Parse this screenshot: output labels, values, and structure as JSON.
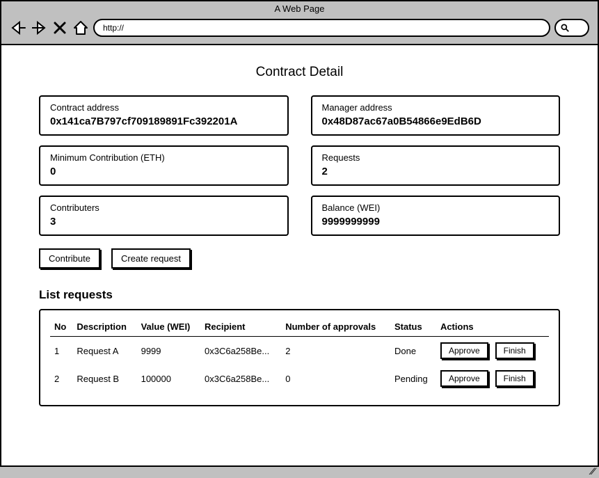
{
  "chrome": {
    "title": "A Web Page",
    "url": "http://"
  },
  "page": {
    "title": "Contract Detail",
    "cards": {
      "contract_address": {
        "label": "Contract address",
        "value": "0x141ca7B797cf709189891Fc392201A"
      },
      "manager_address": {
        "label": "Manager address",
        "value": "0x48D87ac67a0B54866e9EdB6D"
      },
      "min_contribution": {
        "label": "Minimum Contribution (ETH)",
        "value": "0"
      },
      "requests": {
        "label": "Requests",
        "value": "2"
      },
      "contributors": {
        "label": "Contributers",
        "value": "3"
      },
      "balance": {
        "label": "Balance (WEI)",
        "value": "9999999999"
      }
    },
    "actions": {
      "contribute": "Contribute",
      "create_request": "Create request"
    },
    "requests_section": {
      "title": "List requests",
      "headers": {
        "no": "No",
        "description": "Description",
        "value": "Value (WEI)",
        "recipient": "Recipient",
        "approvals": "Number of approvals",
        "status": "Status",
        "actions": "Actions"
      },
      "rows": [
        {
          "no": "1",
          "description": "Request A",
          "value": "9999",
          "recipient": "0x3C6a258Be...",
          "approvals": "2",
          "status": "Done"
        },
        {
          "no": "2",
          "description": "Request B",
          "value": "100000",
          "recipient": "0x3C6a258Be...",
          "approvals": "0",
          "status": "Pending"
        }
      ],
      "row_actions": {
        "approve": "Approve",
        "finish": "Finish"
      }
    }
  }
}
